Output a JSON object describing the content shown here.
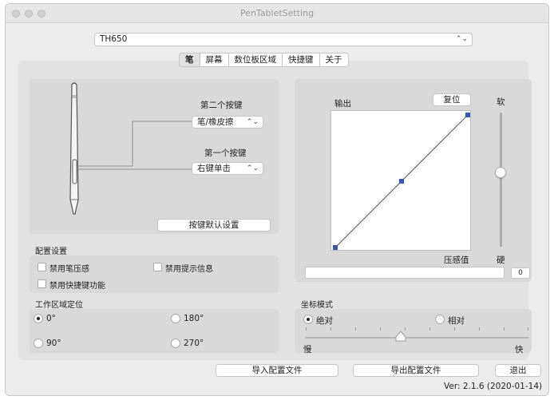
{
  "window": {
    "title": "PenTabletSetting"
  },
  "device_select": {
    "value": "TH650"
  },
  "tabs": [
    {
      "label": "笔",
      "active": true
    },
    {
      "label": "屏幕",
      "active": false
    },
    {
      "label": "数位板区域",
      "active": false
    },
    {
      "label": "快捷键",
      "active": false
    },
    {
      "label": "关于",
      "active": false
    }
  ],
  "pen": {
    "second_button_label": "第二个按键",
    "second_button_value": "笔/橡皮擦",
    "first_button_label": "第一个按键",
    "first_button_value": "右键单击",
    "default_button": "按键默认设置"
  },
  "config": {
    "title": "配置设置",
    "disable_pressure": "禁用笔压感",
    "disable_tips": "禁用提示信息",
    "disable_shortcuts": "禁用快捷键功能"
  },
  "orientation": {
    "title": "工作区域定位",
    "options": [
      "0°",
      "180°",
      "90°",
      "270°"
    ],
    "selected": "0°"
  },
  "pressure": {
    "output_label": "输出",
    "reset_button": "复位",
    "soft_label": "软",
    "hard_label": "硬",
    "pressure_label": "压感值",
    "pressure_value": "0",
    "slider_level": 0.5
  },
  "coord_mode": {
    "title": "坐标模式",
    "absolute": "绝对",
    "relative": "相对",
    "selected": "绝对",
    "slow": "慢",
    "fast": "快",
    "speed_level": 0.43
  },
  "footer": {
    "import_button": "导入配置文件",
    "export_button": "导出配置文件",
    "exit_button": "退出",
    "version": "Ver: 2.1.6 (2020-01-14)"
  }
}
